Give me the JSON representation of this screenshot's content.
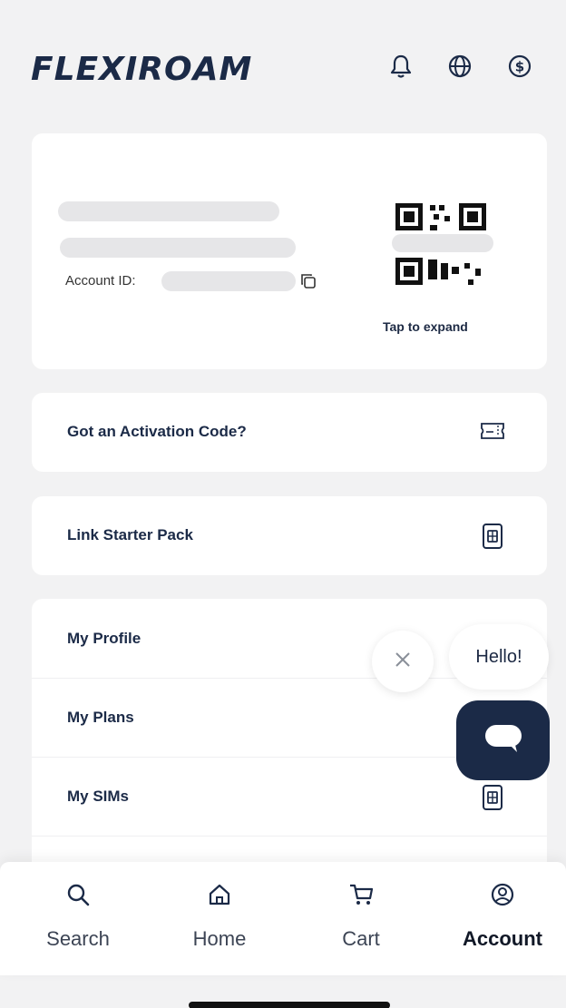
{
  "header": {
    "logo_text": "FLEXIROAM",
    "icons": [
      "bell-icon",
      "globe-icon",
      "currency-icon"
    ]
  },
  "account_card": {
    "account_id_label": "Account ID:",
    "qr_caption": "Tap to expand"
  },
  "activation": {
    "label": "Got an Activation Code?",
    "icon": "ticket-icon"
  },
  "starter_pack": {
    "label": "Link Starter Pack",
    "icon": "sim-card-icon"
  },
  "menu": {
    "items": [
      {
        "label": "My Profile"
      },
      {
        "label": "My Plans"
      },
      {
        "label": "My SIMs",
        "icon": "sim-card-icon"
      }
    ]
  },
  "chat": {
    "greeting": "Hello!"
  },
  "bottom_nav": {
    "items": [
      {
        "label": "Search",
        "icon": "search-icon"
      },
      {
        "label": "Home",
        "icon": "home-icon"
      },
      {
        "label": "Cart",
        "icon": "cart-icon"
      },
      {
        "label": "Account",
        "icon": "account-icon",
        "active": true
      }
    ]
  },
  "colors": {
    "brand_navy": "#1b2a47",
    "background": "#f2f2f3",
    "card": "#ffffff"
  }
}
